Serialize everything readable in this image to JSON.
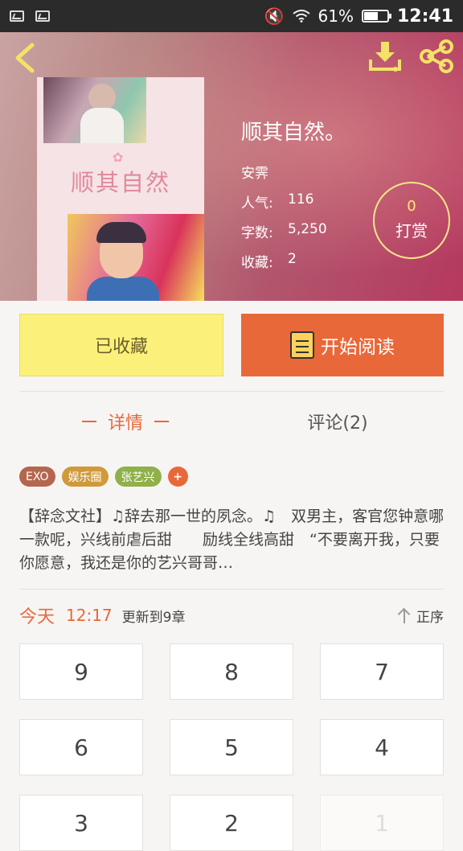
{
  "status_bar": {
    "battery": "61%",
    "battery_level": 0.61,
    "time": "12:41",
    "mute_glyph": "🔇"
  },
  "book": {
    "cover_title": "顺其自然",
    "title": "顺其自然。",
    "author": "安霁",
    "stats": [
      {
        "key": "人气:",
        "value": "116"
      },
      {
        "key": "字数:",
        "value": "5,250"
      },
      {
        "key": "收藏:",
        "value": "2"
      }
    ]
  },
  "reward": {
    "count": "0",
    "label": "打赏"
  },
  "actions": {
    "favorite": "已收藏",
    "read": "开始阅读"
  },
  "tabs": {
    "detail": "详情",
    "comments": "评论(2)"
  },
  "tags": [
    {
      "label": "EXO",
      "color": "#b5664f"
    },
    {
      "label": "娱乐圈",
      "color": "#d09a3a"
    },
    {
      "label": "张艺兴",
      "color": "#8fb04a"
    },
    {
      "label": "+",
      "color": "#e9683a"
    }
  ],
  "description": "【辞念文社】♫辞去那一世的夙念。♫　双男主，客官您钟意哪一款呢，兴线前虐后甜　　励线全线高甜　“不要离开我，只要你愿意，我还是你的艺兴哥哥…",
  "update": {
    "day": "今天",
    "time": "12:17",
    "text": "更新到9章",
    "sort": "正序"
  },
  "chapters": [
    "9",
    "8",
    "7",
    "6",
    "5",
    "4",
    "3",
    "2",
    "1"
  ],
  "colors": {
    "accent": "#e9683a",
    "favorite_bg": "#fbf17a"
  }
}
